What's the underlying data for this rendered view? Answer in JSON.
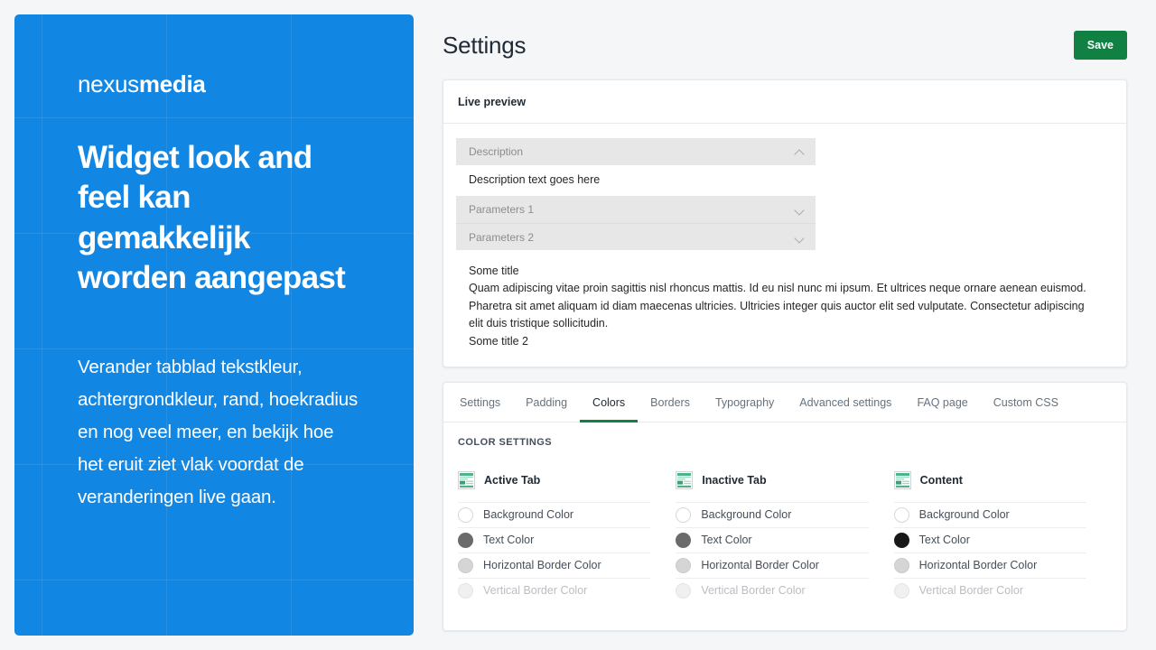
{
  "promo": {
    "brand_light": "nexus",
    "brand_bold": "media",
    "headline": "Widget look and feel kan gemakkelijk worden aangepast",
    "body": "Verander tabblad tekstkleur, achtergrondkleur, rand, hoekradius en nog veel meer, en bekijk hoe het eruit ziet vlak voordat de veranderingen live gaan."
  },
  "header": {
    "title": "Settings",
    "save_label": "Save",
    "save_color": "#108043"
  },
  "live_preview": {
    "card_title": "Live preview",
    "accordion": [
      {
        "label": "Description",
        "chevron": "chevron-up-icon",
        "expanded": true
      },
      {
        "label": "Parameters 1",
        "chevron": "chevron-down-icon",
        "expanded": false
      },
      {
        "label": "Parameters 2",
        "chevron": "chevron-down-icon",
        "expanded": false
      }
    ],
    "description_text": "Description text goes here",
    "some_title": "Some title",
    "paragraph": "Quam adipiscing vitae proin sagittis nisl rhoncus mattis. Id eu nisl nunc mi ipsum. Et ultrices neque ornare aenean euismod. Pharetra sit amet aliquam id diam maecenas ultricies. Ultricies integer quis auctor elit sed vulputate. Consectetur adipiscing elit duis tristique sollicitudin.",
    "some_title_2": "Some title 2"
  },
  "tabs": {
    "items": [
      {
        "label": "Settings",
        "active": false
      },
      {
        "label": "Padding",
        "active": false
      },
      {
        "label": "Colors",
        "active": true
      },
      {
        "label": "Borders",
        "active": false
      },
      {
        "label": "Typography",
        "active": false
      },
      {
        "label": "Advanced settings",
        "active": false
      },
      {
        "label": "FAQ page",
        "active": false
      },
      {
        "label": "Custom CSS",
        "active": false
      }
    ],
    "active_indicator_color": "#108043"
  },
  "color_settings": {
    "section_title": "COLOR SETTINGS",
    "columns": [
      {
        "title": "Active Tab",
        "icon": "layout-wireframe-icon",
        "options": [
          {
            "label": "Background Color",
            "swatch": "white",
            "disabled": false
          },
          {
            "label": "Text Color",
            "swatch": "gray",
            "disabled": false
          },
          {
            "label": "Horizontal Border Color",
            "swatch": "lightgray",
            "disabled": false
          },
          {
            "label": "Vertical Border Color",
            "swatch": "faint",
            "disabled": true
          }
        ]
      },
      {
        "title": "Inactive Tab",
        "icon": "layout-wireframe-icon",
        "options": [
          {
            "label": "Background Color",
            "swatch": "white",
            "disabled": false
          },
          {
            "label": "Text Color",
            "swatch": "gray",
            "disabled": false
          },
          {
            "label": "Horizontal Border Color",
            "swatch": "lightgray",
            "disabled": false
          },
          {
            "label": "Vertical Border Color",
            "swatch": "faint",
            "disabled": true
          }
        ]
      },
      {
        "title": "Content",
        "icon": "layout-wireframe-icon",
        "options": [
          {
            "label": "Background Color",
            "swatch": "white",
            "disabled": false
          },
          {
            "label": "Text Color",
            "swatch": "black",
            "disabled": false
          },
          {
            "label": "Horizontal Border Color",
            "swatch": "lightgray",
            "disabled": false
          },
          {
            "label": "Vertical Border Color",
            "swatch": "faint",
            "disabled": true
          }
        ]
      }
    ]
  },
  "theme": {
    "promo_blue": "#1286e3",
    "page_background": "#f4f6f8",
    "accent_green": "#108043"
  }
}
